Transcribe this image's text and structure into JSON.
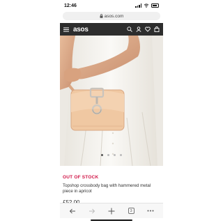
{
  "status_bar": {
    "time": "12:46"
  },
  "browser": {
    "url": "asos.com",
    "tabs_count": "3"
  },
  "site_header": {
    "logo": "asos"
  },
  "product": {
    "stock_status": "OUT OF STOCK",
    "name": "Topshop crossbody bag with hammered metal piece in apricot",
    "price": "£52.00"
  },
  "carousel": {
    "total": 4,
    "active": 0
  },
  "colors": {
    "header_bg": "#2d2d2d",
    "stock_red": "#d01345",
    "bag": "#f0c8a2"
  }
}
